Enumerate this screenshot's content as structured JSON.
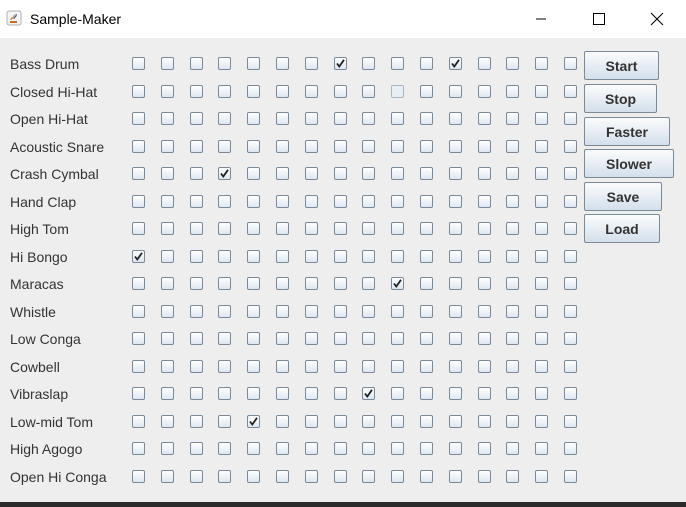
{
  "window": {
    "title": "Sample-Maker"
  },
  "instruments": [
    "Bass Drum",
    "Closed Hi-Hat",
    "Open Hi-Hat",
    "Acoustic Snare",
    "Crash Cymbal",
    "Hand Clap",
    "High Tom",
    "Hi Bongo",
    "Maracas",
    "Whistle",
    "Low Conga",
    "Cowbell",
    "Vibraslap",
    "Low-mid Tom",
    "High Agogo",
    "Open Hi Conga"
  ],
  "beats": 16,
  "checked": {
    "Bass Drum": [
      8,
      12
    ],
    "Crash Cymbal": [
      4
    ],
    "Hi Bongo": [
      1
    ],
    "Maracas": [
      10
    ],
    "Vibraslap": [
      9
    ],
    "Low-mid Tom": [
      5
    ]
  },
  "disabled": {
    "Closed Hi-Hat": [
      10
    ]
  },
  "buttons": {
    "start": "Start",
    "stop": "Stop",
    "faster": "Faster",
    "slower": "Slower",
    "save": "Save",
    "load": "Load"
  },
  "colors": {
    "checkbox_border": "#7a8a99",
    "check_mark": "#222222",
    "background": "#eeeeee"
  },
  "icons": [
    "java-app-icon",
    "minimize-icon",
    "maximize-icon",
    "close-icon",
    "check-icon"
  ]
}
